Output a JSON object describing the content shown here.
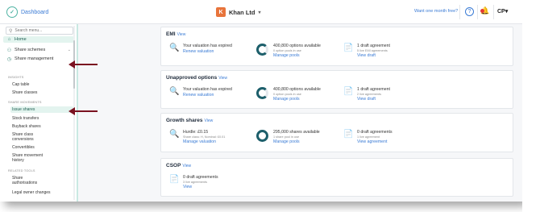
{
  "brand": {
    "name": "Dashboard"
  },
  "company": {
    "badge": "K",
    "name": "Khan Ltd"
  },
  "topbar": {
    "trial_link": "Want one month free?",
    "user_initials": "CP"
  },
  "colors": {
    "accent": "#3a7bd5",
    "brand": "#4fb3a3",
    "arrow": "#7a1220",
    "donut": "#1d5f6b"
  },
  "sidebar": {
    "search_placeholder": "Search menu...",
    "home": "Home",
    "share_schemes": "Share schemes",
    "share_management": "Share management",
    "insights_label": "INSIGHTS",
    "cap_table": "Cap table",
    "share_classes": "Share classes",
    "share_movements_label": "SHARE MOVEMENTS",
    "issue_shares": "Issue shares",
    "stock_transfers": "Stock transfers",
    "buyback_shares": "Buyback shares",
    "share_class_conversions": "Share class conversions",
    "convertibles": "Convertibles",
    "share_movement_history": "Share movement history",
    "related_tools_label": "RELATED TOOLS",
    "share_authorisations": "Share authorisations",
    "legal_owner_changes": "Legal owner changes"
  },
  "cards": {
    "emi": {
      "title": "EMI",
      "view": "View",
      "valuation_main": "Your valuation has expired",
      "valuation_link": "Renew valuation",
      "options_main": "400,800 options available",
      "options_sub": "0 option pools in use",
      "options_link": "Manage pools",
      "draft_main": "1 draft agreement",
      "draft_sub": "5 live EMI agreements",
      "draft_link": "View draft"
    },
    "unapproved": {
      "title": "Unapproved options",
      "view": "View",
      "valuation_main": "Your valuation has expired",
      "valuation_link": "Renew valuation",
      "options_main": "400,800 options available",
      "options_sub": "0 option pools in use",
      "options_link": "Manage pools",
      "draft_main": "1 draft agreement",
      "draft_sub": "2 live agreements",
      "draft_link": "View draft"
    },
    "growth": {
      "title": "Growth shares",
      "view": "View",
      "valuation_main": "Hurdle: £0.15",
      "valuation_sub": "Share class: H, Nominal: £0.01",
      "valuation_link": "Manage valuation",
      "options_main": "295,000 shares available",
      "options_sub": "1 share pool in use",
      "options_link": "Manage pools",
      "draft_main": "0 draft agreements",
      "draft_sub": "1 live agreement",
      "draft_link": "View agreement"
    },
    "csop": {
      "title": "CSOP",
      "view": "View",
      "draft_main": "0 draft agreements",
      "draft_sub": "3 live agreements",
      "draft_link": "View"
    }
  }
}
